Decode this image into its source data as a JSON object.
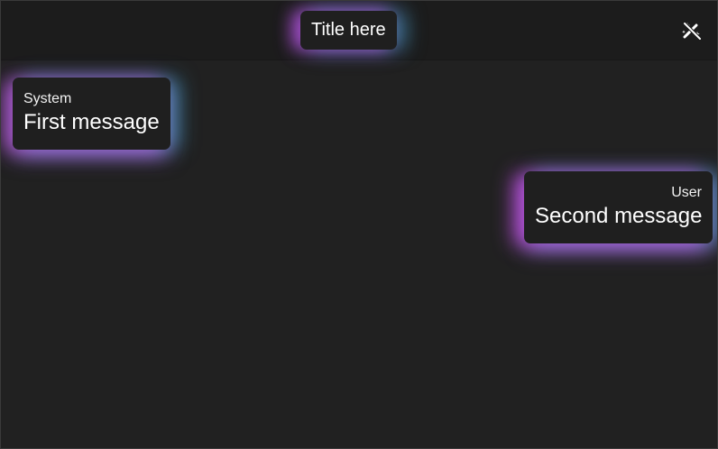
{
  "header": {
    "title": "Title here",
    "effects_icon": "magic-wand-off-icon"
  },
  "messages": [
    {
      "sender": "System",
      "text": "First message"
    },
    {
      "sender": "User",
      "text": "Second message"
    }
  ],
  "colors": {
    "background": "#212121",
    "header_background": "#1c1c1c",
    "bubble_background": "#1f1f1f",
    "glow_purple": "#c05ae6",
    "glow_cyan": "#46aad7",
    "text": "#ffffff"
  }
}
